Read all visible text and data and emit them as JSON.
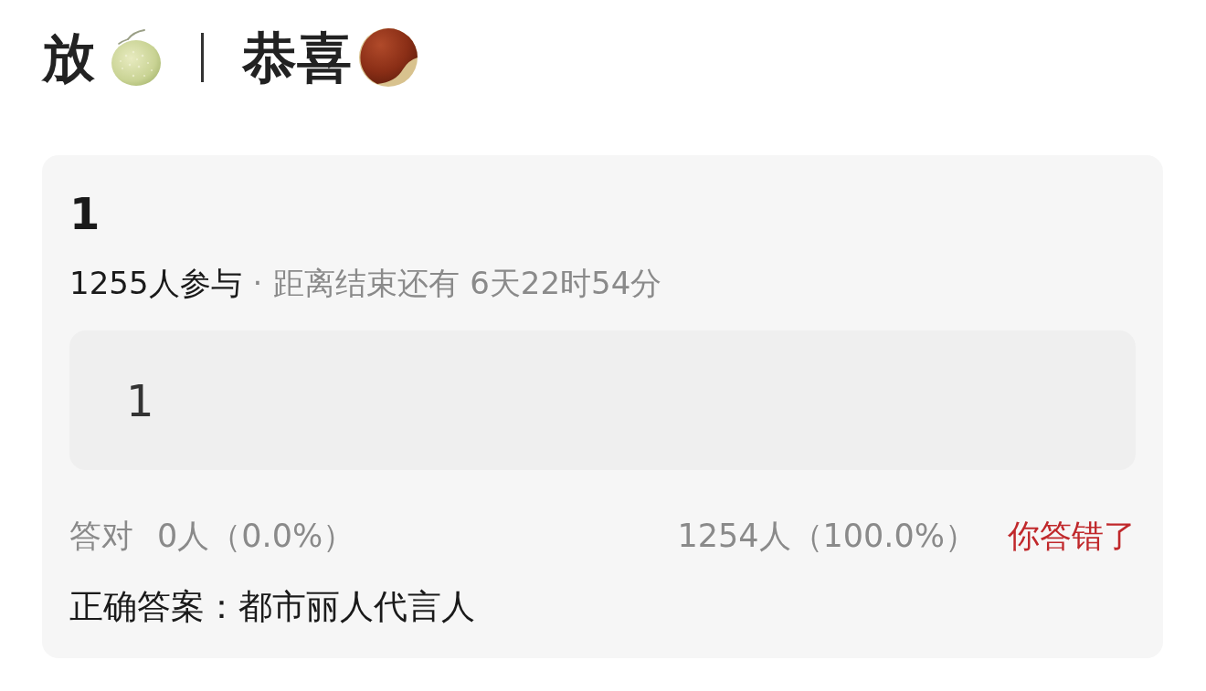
{
  "header": {
    "left_text": "放",
    "right_text": "恭喜"
  },
  "poll": {
    "title": "1",
    "participants": "1255人参与",
    "separator": "·",
    "deadline": "距离结束还有 6天22时54分",
    "options": [
      {
        "label": "1"
      }
    ]
  },
  "results": {
    "correct_label": "答对",
    "correct_count": "0人（0.0%）",
    "chosen_count": "1254人（100.0%）",
    "verdict": {
      "text": "你答错了",
      "correct": false
    }
  },
  "answer": "正确答案：都市丽人代言人"
}
